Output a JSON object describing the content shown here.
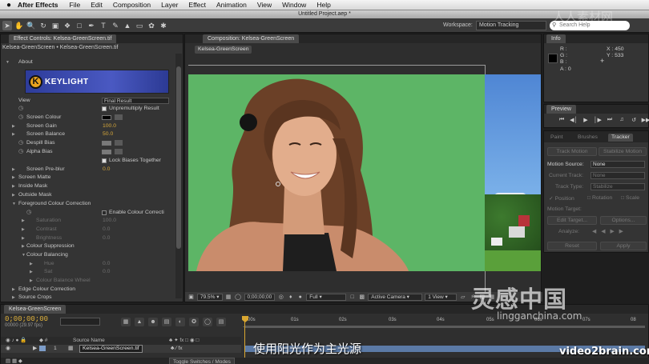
{
  "menubar": {
    "app": "After Effects",
    "items": [
      "File",
      "Edit",
      "Composition",
      "Layer",
      "Effect",
      "Animation",
      "View",
      "Window",
      "Help"
    ]
  },
  "window": {
    "title": "Untitled Project.aep *"
  },
  "toolbar": {
    "workspace_label": "Workspace:",
    "workspace_value": "Motion Tracking",
    "search_placeholder": "Search Help"
  },
  "effect_controls": {
    "tab": "Effect Controls: Kelsea-GreenScreen.tif",
    "subtitle": "Kelsea-GreenScreen • Kelsea-GreenScreen.tif",
    "logo_text": "KEYLIGHT",
    "rows": [
      {
        "label": "About",
        "value": ""
      },
      {
        "label": "View",
        "value": "Final Result"
      },
      {
        "label": "",
        "value": "Unpremultiply Result"
      },
      {
        "label": "Screen Colour",
        "value": ""
      },
      {
        "label": "Screen Gain",
        "value": "100.0"
      },
      {
        "label": "Screen Balance",
        "value": "50.0"
      },
      {
        "label": "Despill Bias",
        "value": ""
      },
      {
        "label": "Alpha Bias",
        "value": ""
      },
      {
        "label": "",
        "value": "Lock Biases Together"
      },
      {
        "label": "Screen Pre-blur",
        "value": "0.0"
      },
      {
        "label": "Screen Matte",
        "value": ""
      },
      {
        "label": "Inside Mask",
        "value": ""
      },
      {
        "label": "Outside Mask",
        "value": ""
      },
      {
        "label": "Foreground Colour Correction",
        "value": ""
      },
      {
        "label": "",
        "value": "Enable Colour Correcti"
      },
      {
        "label": "Saturation",
        "value": "100.0"
      },
      {
        "label": "Contrast",
        "value": "0.0"
      },
      {
        "label": "Brightness",
        "value": "0.0"
      },
      {
        "label": "Colour Suppression",
        "value": ""
      },
      {
        "label": "Colour Balancing",
        "value": ""
      },
      {
        "label": "Hue",
        "value": "0.0"
      },
      {
        "label": "Sat",
        "value": "0.0"
      },
      {
        "label": "Colour Balance Wheel",
        "value": ""
      },
      {
        "label": "Edge Colour Correction",
        "value": ""
      },
      {
        "label": "Source Crops",
        "value": ""
      }
    ]
  },
  "composition": {
    "tab": "Composition: Kelsea-GreenScreen",
    "subtab": "Kelsea-GreenScreen",
    "footer": {
      "zoom": "79.5%",
      "timecode": "0;00;00;00",
      "resolution": "Full",
      "camera": "Active Camera",
      "views": "1 View"
    }
  },
  "info": {
    "tab": "Info",
    "channels": [
      "R :",
      "G :",
      "B :",
      "A : 0"
    ],
    "x": "X : 450",
    "y": "Y : 533"
  },
  "preview": {
    "tab": "Preview"
  },
  "tracker": {
    "tabs": [
      "Paint",
      "Brushes",
      "Tracker"
    ],
    "track_motion": "Track Motion",
    "stabilize_motion": "Stabilize Motion",
    "motion_source_label": "Motion Source:",
    "motion_source_value": "None",
    "current_track_label": "Current Track:",
    "current_track_value": "None",
    "track_type_label": "Track Type:",
    "track_type_value": "Stabilize",
    "position": "Position",
    "rotation": "Rotation",
    "scale": "Scale",
    "motion_target": "Motion Target:",
    "edit_target": "Edit Target...",
    "options": "Options...",
    "analyze": "Analyze:",
    "reset": "Reset",
    "apply": "Apply"
  },
  "timeline": {
    "tab": "Kelsea-GreenScreen",
    "timecode": "0;00;00;00",
    "frames": "00000 (29.97 fps)",
    "ticks": [
      "00s",
      "01s",
      "02s",
      "03s",
      "04s",
      "05s",
      "06s",
      "07s",
      "08"
    ],
    "source_name_header": "Source Name",
    "layer_number": "1",
    "layer_name": "Kelsea-GreenScreen.tif",
    "toggle_label": "Toggle Switches / Modes"
  },
  "subtitle": "使用阳光作为主光源",
  "watermarks": {
    "logo": "灵感中国",
    "url": "lingganchina.com",
    "brand": "video2brain.com",
    "top": "人人素材网"
  }
}
